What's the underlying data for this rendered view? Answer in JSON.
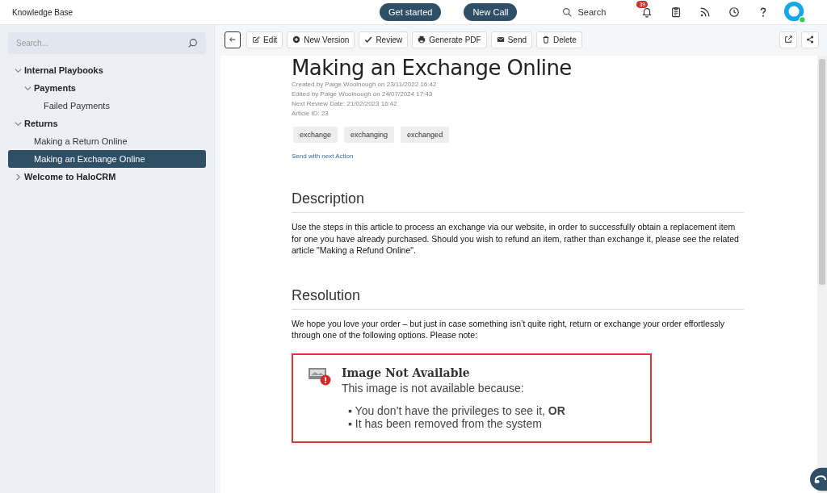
{
  "header": {
    "title": "Knowledge Base",
    "actions": [
      "Get started",
      "New Call"
    ],
    "search": "Search",
    "notifications": "39"
  },
  "sidebar": {
    "search": {
      "placeholder": "Search..."
    },
    "tree": [
      {
        "label": "Internal Playbooks",
        "expanded": true,
        "selected": false,
        "children": [
          {
            "label": "Payments",
            "expanded": true,
            "selected": false,
            "children": [
              {
                "label": "Failed Payments",
                "selected": false
              }
            ]
          }
        ]
      },
      {
        "label": "Returns",
        "expanded": true,
        "selected": false,
        "children": [
          {
            "label": "Making a Return Online",
            "selected": false
          },
          {
            "label": "Making an Exchange Online",
            "selected": true
          }
        ]
      },
      {
        "label": "Welcome to HaloCRM",
        "expanded": false,
        "selected": false
      }
    ]
  },
  "toolbar": [
    {
      "kind": "edit",
      "label": "Edit"
    },
    {
      "kind": "plus",
      "label": "New Version"
    },
    {
      "kind": "check",
      "label": "Review"
    },
    {
      "kind": "print",
      "label": "Generate PDF"
    },
    {
      "kind": "mail",
      "label": "Send"
    },
    {
      "kind": "trash",
      "label": "Delete"
    }
  ],
  "article": {
    "title": "Making an Exchange Online",
    "meta": [
      "Created by Paige Woolnough on 23/11/2022 16:42",
      "Edited by Paige Woolnough on 24/07/2024 17:43",
      "Next Review Date: 21/02/2023 16:42",
      "Article ID: 23"
    ],
    "tags": [
      "exchange",
      "exchanging",
      "exchanged"
    ],
    "link": "Send with next Action",
    "sections": [
      {
        "heading": "Description",
        "text": "Use the steps in this article to process an exchange via our website, in order to successfully obtain a replacement item for one you have already purchased. Should you wish to refund an item, rather than exchange it, please see the related article \"Making a Refund Online\"."
      },
      {
        "heading": "Resolution",
        "text": "We hope you love your order – but just in case something isn’t quite right, return or exchange your order effortlessly through one of the following options. Please note:"
      }
    ],
    "notice": {
      "title": "Image Not Available",
      "text": "This image is not available because:",
      "reasons": [
        "▪ You don’t have the privileges to see it, **OR**",
        "▪ It has been removed from the system"
      ]
    }
  }
}
